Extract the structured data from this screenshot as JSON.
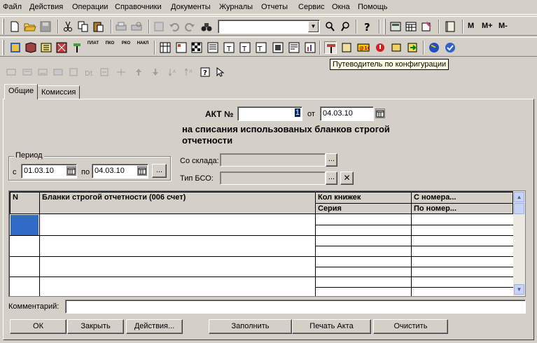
{
  "menu": [
    "Файл",
    "Действия",
    "Операции",
    "Справочники",
    "Документы",
    "Журналы",
    "Отчеты",
    "Сервис",
    "Окна",
    "Помощь"
  ],
  "toolbar": {
    "search_value": "",
    "memory_labels": [
      "M",
      "M+",
      "M-"
    ],
    "tooltip": "Путеводитель по конфигурации",
    "doc_icon_labels": [
      "ПЛАТ",
      "ПКО",
      "РКО",
      "НАКЛ"
    ]
  },
  "tabs": [
    "Общие",
    "Комиссия"
  ],
  "form": {
    "act_label": "АКТ №",
    "act_number": "1",
    "from_label": "от",
    "act_date": "04.03.10",
    "subtitle": "на списания использованых бланков строгой отчетности",
    "period": {
      "title": "Период",
      "from_label": "с",
      "from_date": "01.03.10",
      "to_label": "по",
      "to_date": "04.03.10"
    },
    "warehouse_label": "Со склада:",
    "warehouse_value": "",
    "bso_type_label": "Тип БСО:",
    "bso_type_value": ""
  },
  "table": {
    "columns": {
      "n": "N",
      "blanks": "Бланки строгой отчетности (006 счет)",
      "qty": "Кол книжек",
      "series": "Серия",
      "from_num": "С номера...",
      "to_num": "По номер..."
    }
  },
  "comment": {
    "label": "Комментарий:",
    "value": ""
  },
  "buttons": {
    "ok": "ОК",
    "close": "Закрыть",
    "actions": "Действия...",
    "fill": "Заполнить",
    "print": "Печать Акта",
    "clear": "Очистить"
  }
}
